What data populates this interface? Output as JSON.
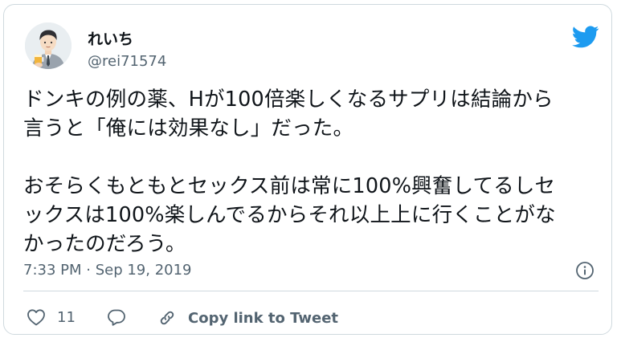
{
  "author": {
    "display_name": "れいち",
    "handle": "@rei71574"
  },
  "tweet": {
    "lines": [
      "ドンキの例の薬、Hが100倍楽しくなるサプリは結論から",
      "言うと「俺には効果なし」だった。",
      "",
      "おそらくもともとセックス前は常に100%興奮してるしセ",
      "ックスは100%楽しんでるからそれ以上上に行くことがな",
      "かったのだろう。"
    ]
  },
  "meta": {
    "timestamp": "7:33 PM · Sep 19, 2019"
  },
  "actions": {
    "like_count": "11",
    "copy_link_label": "Copy link to Tweet"
  },
  "colors": {
    "brand_blue": "#1d9bf0",
    "secondary_text": "#536471",
    "border": "#cfd9de"
  },
  "icons": [
    "avatar-illustration",
    "twitter-bird-icon",
    "info-icon",
    "heart-icon",
    "reply-icon",
    "link-icon"
  ]
}
